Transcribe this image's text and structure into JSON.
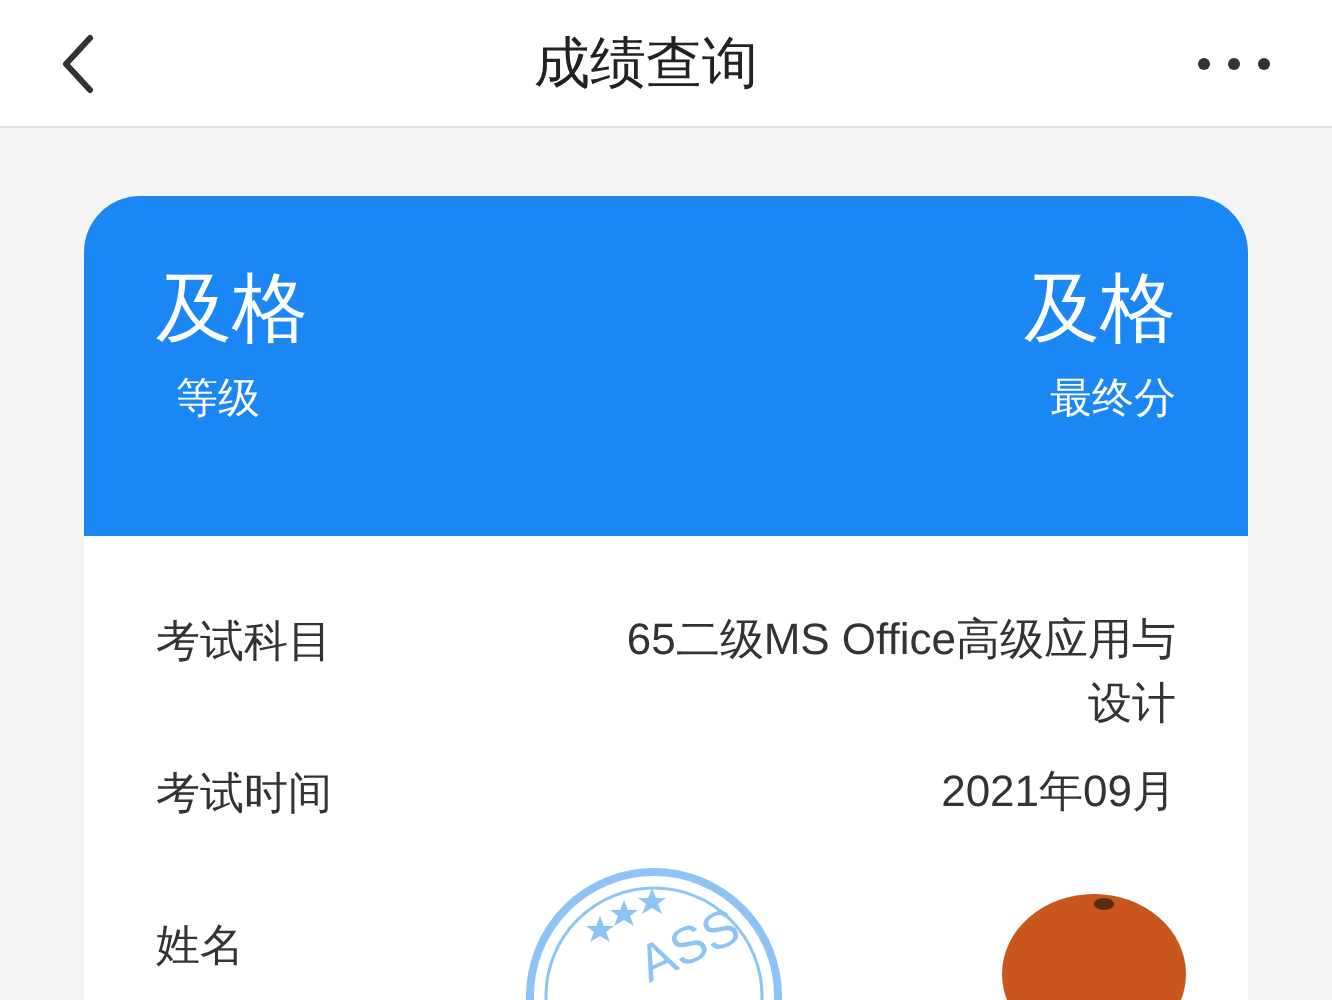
{
  "nav": {
    "title": "成绩查询"
  },
  "summary": [
    {
      "value": "及格",
      "label": "等级"
    },
    {
      "value": "及格",
      "label": "最终分"
    }
  ],
  "details": [
    {
      "label": "考试科目",
      "value": "65二级MS Office高级应用与设计"
    },
    {
      "label": "考试时间",
      "value": "2021年09月"
    },
    {
      "label": "姓名"
    }
  ],
  "stamp": {
    "text": "ASS"
  }
}
